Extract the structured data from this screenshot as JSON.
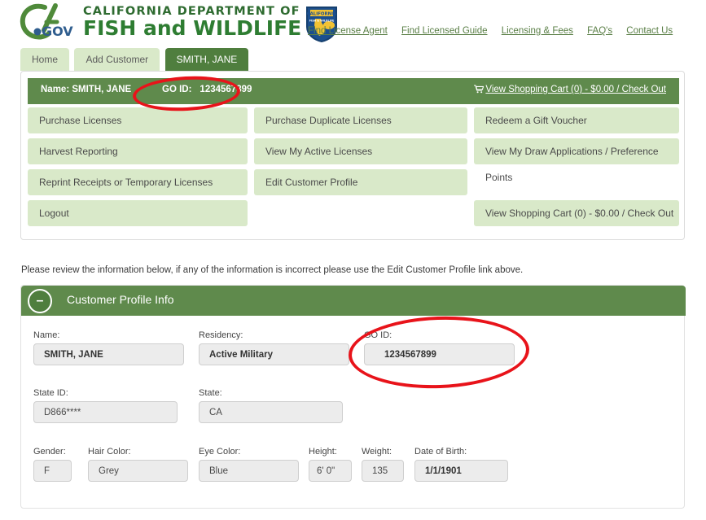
{
  "brand": {
    "ca_mark": "CA.GOV",
    "dept_line1": "CALIFORNIA DEPARTMENT OF",
    "dept_line2": "FISH and WILDLIFE",
    "shield_top": "CALIFORNIA",
    "shield_sub": "FISH & WILDLIFE"
  },
  "top_links": [
    {
      "label": "Find License Agent"
    },
    {
      "label": "Find Licensed Guide"
    },
    {
      "label": "Licensing & Fees"
    },
    {
      "label": "FAQ's"
    },
    {
      "label": "Contact Us"
    }
  ],
  "tabs": [
    {
      "label": "Home",
      "active": false
    },
    {
      "label": "Add Customer",
      "active": false
    },
    {
      "label": "SMITH, JANE",
      "active": true
    }
  ],
  "customer_bar": {
    "name_label": "Name: SMITH, JANE",
    "goid_label": "GO ID:",
    "goid_value": "1234567899",
    "cart_link": "View Shopping Cart (0) - $0.00 / Check Out",
    "cart_icon": "shopping-cart-icon"
  },
  "menu": {
    "rows": [
      [
        {
          "label": "Purchase Licenses",
          "blank": false
        },
        {
          "label": "Purchase Duplicate Licenses",
          "blank": false
        },
        {
          "label": "Redeem a Gift Voucher",
          "blank": false
        }
      ],
      [
        {
          "label": "Harvest Reporting",
          "blank": false
        },
        {
          "label": "View My Active Licenses",
          "blank": false
        },
        {
          "label": "View My Draw Applications / Preference Points",
          "blank": false
        }
      ],
      [
        {
          "label": "Reprint Receipts or Temporary Licenses",
          "blank": false
        },
        {
          "label": "Edit Customer Profile",
          "blank": false
        },
        {
          "label": "",
          "blank": true
        }
      ],
      [
        {
          "label": "Logout",
          "blank": false
        },
        {
          "label": "",
          "blank": true
        },
        {
          "label": "View Shopping Cart (0) - $0.00 / Check Out",
          "blank": false
        }
      ]
    ]
  },
  "notice": "Please review the information below, if any of the information is incorrect please use the Edit Customer Profile link above.",
  "profile": {
    "title": "Customer Profile Info",
    "collapse_icon": "minus-icon",
    "collapse_glyph": "–",
    "fields": {
      "name": {
        "label": "Name:",
        "value": "SMITH, JANE"
      },
      "residency": {
        "label": "Residency:",
        "value": "Active Military"
      },
      "go_id": {
        "label": "GO ID:",
        "value": "1234567899"
      },
      "state_id": {
        "label": "State ID:",
        "value": "D866****"
      },
      "state": {
        "label": "State:",
        "value": "CA"
      },
      "gender": {
        "label": "Gender:",
        "value": "F"
      },
      "hair_color": {
        "label": "Hair Color:",
        "value": "Grey"
      },
      "eye_color": {
        "label": "Eye Color:",
        "value": "Blue"
      },
      "height": {
        "label": "Height:",
        "value": "6' 0\""
      },
      "weight": {
        "label": "Weight:",
        "value": "135"
      },
      "dob": {
        "label": "Date of Birth:",
        "value": "1/1/1901"
      }
    }
  },
  "annotations": [
    {
      "name": "red-ellipse-goid-header",
      "shape": "ellipse",
      "color": "#e8131a"
    },
    {
      "name": "red-ellipse-goid-field",
      "shape": "ellipse",
      "color": "#e8131a"
    }
  ],
  "colors": {
    "brand_green": "#2e7d32",
    "header_green": "#5f8a4c",
    "tab_active": "#4f7e3e",
    "tab_inactive": "#d9e9c9",
    "button_green": "#d9e9c9",
    "annotation_red": "#e8131a",
    "input_grey": "#ececec"
  }
}
